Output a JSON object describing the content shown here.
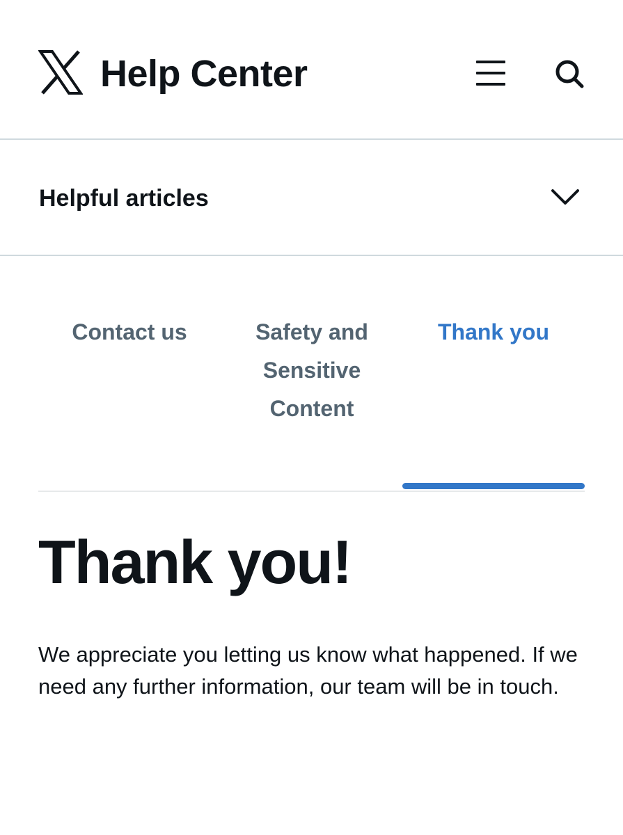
{
  "header": {
    "title": "Help Center",
    "logo_icon": "x-logo-icon",
    "menu_icon": "hamburger-menu-icon",
    "search_icon": "search-icon"
  },
  "articles": {
    "label": "Helpful articles",
    "toggle_icon": "chevron-down-icon"
  },
  "tabs": [
    {
      "label": "Contact us",
      "active": false
    },
    {
      "label": "Safety and Sensitive Content",
      "active": false
    },
    {
      "label": "Thank you",
      "active": true
    }
  ],
  "colors": {
    "text": "#0f1419",
    "tab_inactive": "#536471",
    "accent": "#3277c8",
    "divider": "#cfd9de"
  },
  "main": {
    "title": "Thank you!",
    "body": "We appreciate you letting us know what happened. If we need any further information, our team will be in touch."
  }
}
